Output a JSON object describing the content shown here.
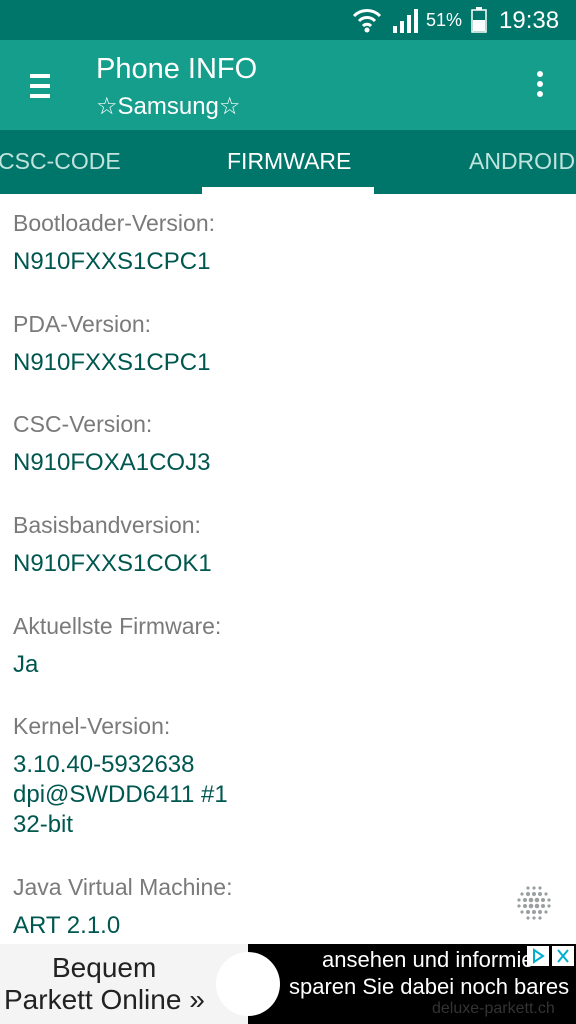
{
  "status_bar": {
    "battery_percent": "51%",
    "time": "19:38"
  },
  "app_bar": {
    "title": "Phone INFO",
    "subtitle": "☆Samsung☆"
  },
  "tabs": [
    {
      "label": "CSC-CODE",
      "active": false
    },
    {
      "label": "FIRMWARE",
      "active": true
    },
    {
      "label": "ANDROID",
      "active": false
    }
  ],
  "firmware": [
    {
      "label": "Bootloader-Version:",
      "value": "N910FXXS1CPC1"
    },
    {
      "label": "PDA-Version:",
      "value": "N910FXXS1CPC1"
    },
    {
      "label": "CSC-Version:",
      "value": "N910FOXA1COJ3"
    },
    {
      "label": "Basisbandversion:",
      "value": "N910FXXS1COK1"
    },
    {
      "label": "Aktuellste Firmware:",
      "value": "Ja"
    },
    {
      "label": "Kernel-Version:",
      "value": "3.10.40-5932638\ndpi@SWDD6411 #1\n32-bit"
    },
    {
      "label": "Java Virtual Machine:",
      "value": "ART 2.1.0"
    }
  ],
  "ad": {
    "left_line1": "Bequem",
    "left_line2": "Parkett Online »",
    "right_line1": "ansehen und informie",
    "right_line2": "sparen Sie dabei noch bares",
    "right_line3": "deluxe-parkett.ch"
  },
  "colors": {
    "status_bar": "#00766a",
    "app_bar": "#169e8c",
    "tab_bar": "#00766a",
    "value_text": "#00574f",
    "label_text": "#7a7a7a"
  },
  "icons": [
    "wifi-icon",
    "signal-icon",
    "battery-icon",
    "menu-icon",
    "overflow-menu-icon",
    "dots-grid-icon",
    "ad-choices-icon",
    "close-icon"
  ]
}
